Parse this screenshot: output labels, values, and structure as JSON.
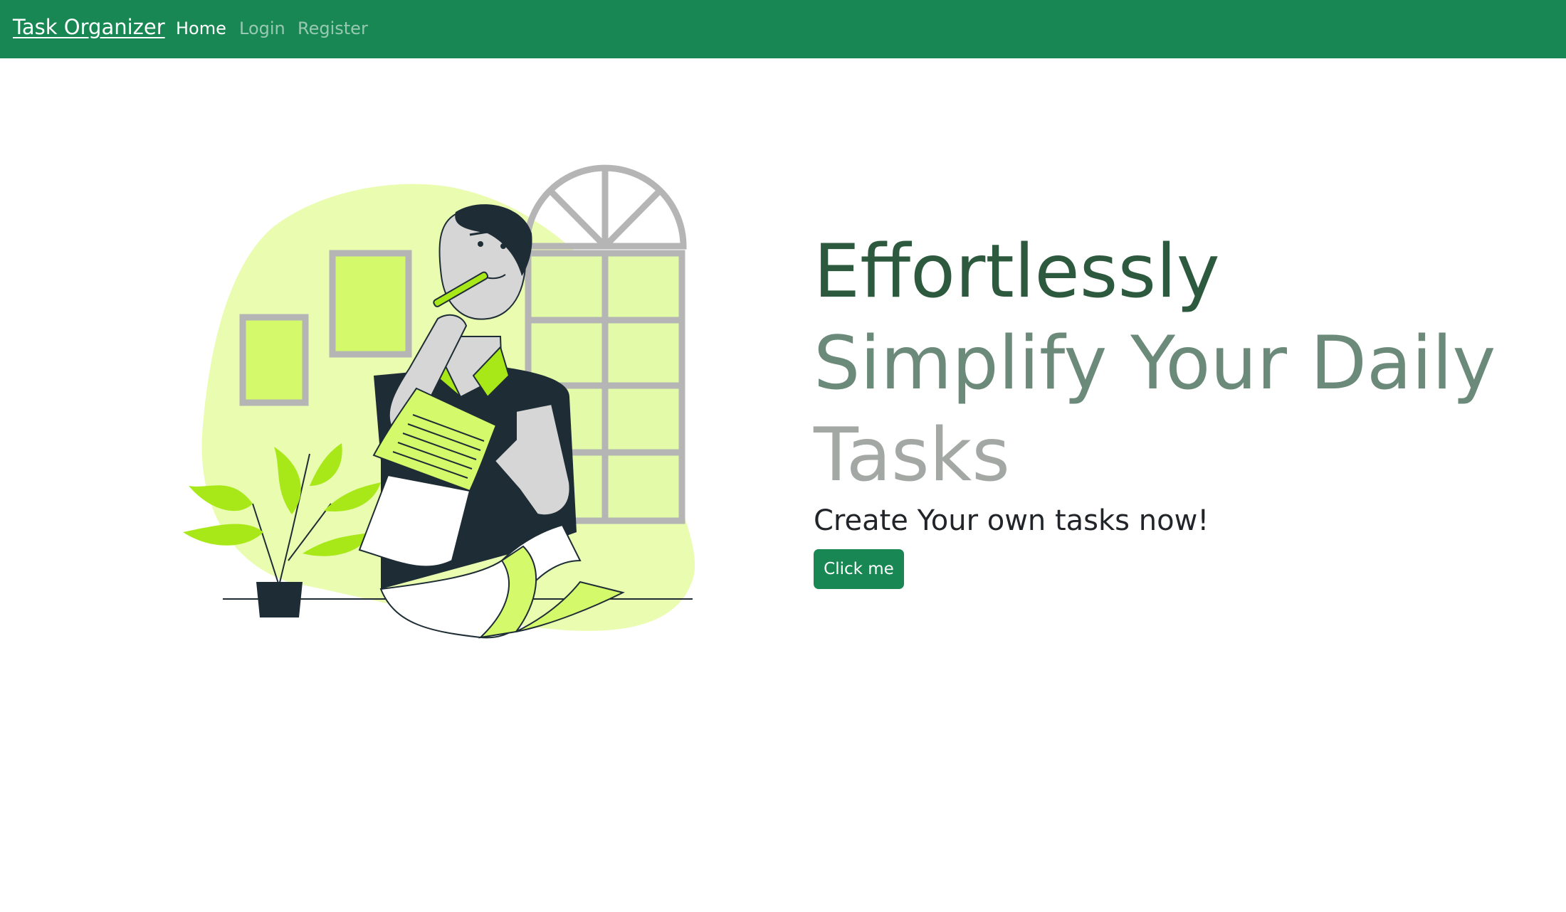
{
  "navbar": {
    "brand": "Task Organizer",
    "links": [
      {
        "label": "Home",
        "active": true
      },
      {
        "label": "Login",
        "active": false
      },
      {
        "label": "Register",
        "active": false
      }
    ],
    "color": "#198754"
  },
  "hero": {
    "heading_lines": [
      "Effortlessly",
      "Simplify Your Daily",
      "Tasks"
    ],
    "subheading": "Create Your own tasks now!",
    "button_label": "Click me",
    "illustration": "person-reviewing-checklist-illustration"
  },
  "colors": {
    "accent_green": "#198754",
    "lime": "#d4fa6b",
    "light_lime": "#e9fcb0"
  }
}
